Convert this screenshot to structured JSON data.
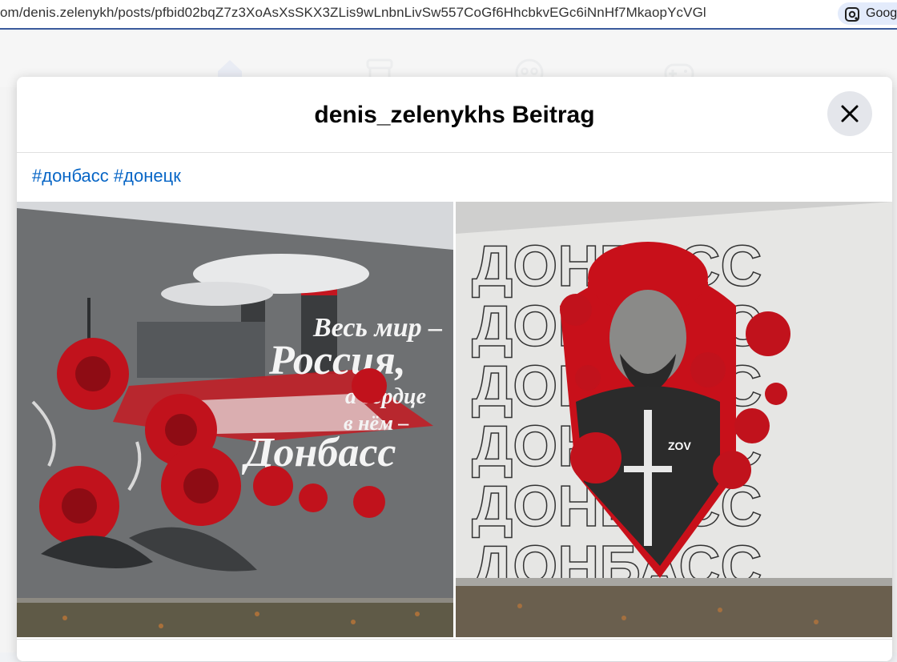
{
  "browser": {
    "url": "om/denis.zelenykh/posts/pfbid02bqZ7z3XoAsXsSKX3ZLis9wLnbnLivSw557CoGf6HhcbkvEGc6iNnHf7MkaopYcVGl",
    "lens_label": "Goog"
  },
  "nav": {
    "icons": [
      "home-icon",
      "marketplace-icon",
      "groups-icon",
      "gaming-icon"
    ]
  },
  "dialog": {
    "title": "denis_zelenykhs Beitrag",
    "hashtags": [
      "#донбасс",
      "#донецк"
    ],
    "photos": [
      {
        "description_overlay": "Весь мир – Россия, а сердце в нём – Донбасс",
        "lines": [
          "Весь мир –",
          "Россия,",
          "а сердце",
          "в нём –",
          "Донбасс"
        ]
      },
      {
        "repeated_text": "ДОНБАСС",
        "badge": "ZOV"
      }
    ]
  },
  "colors": {
    "accent": "#0866c6",
    "rose_red": "#d4101c",
    "wall_grey": "#6e7072"
  }
}
